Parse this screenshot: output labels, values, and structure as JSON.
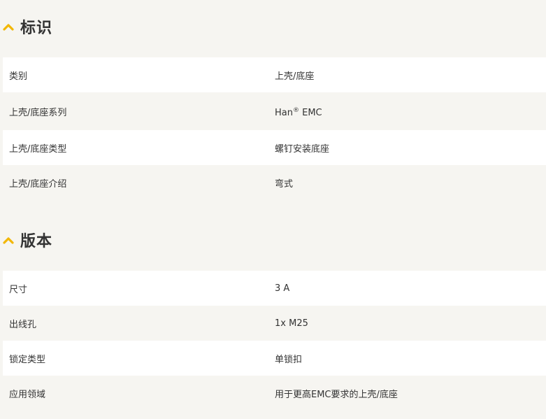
{
  "colors": {
    "accent": "#f2b705",
    "page_background": "#f6f5f1",
    "row_background": "#ffffff",
    "text": "#333333"
  },
  "sections": [
    {
      "title": "标识",
      "icon": "chevron-up-icon",
      "rows": [
        {
          "label": "类别",
          "value": "上壳/底座"
        },
        {
          "label": "上壳/底座系列",
          "value": "Han",
          "value_sup": "®",
          "value_suffix": " EMC"
        },
        {
          "label": "上壳/底座类型",
          "value": "螺钉安装底座"
        },
        {
          "label": "上壳/底座介绍",
          "value": "弯式"
        }
      ]
    },
    {
      "title": "版本",
      "icon": "chevron-up-icon",
      "rows": [
        {
          "label": "尺寸",
          "value": "3 A"
        },
        {
          "label": "出线孔",
          "value": "1x M25"
        },
        {
          "label": "锁定类型",
          "value": "单锁扣"
        },
        {
          "label": "应用领域",
          "value": "用于更高EMC要求的上壳/底座"
        }
      ]
    }
  ]
}
